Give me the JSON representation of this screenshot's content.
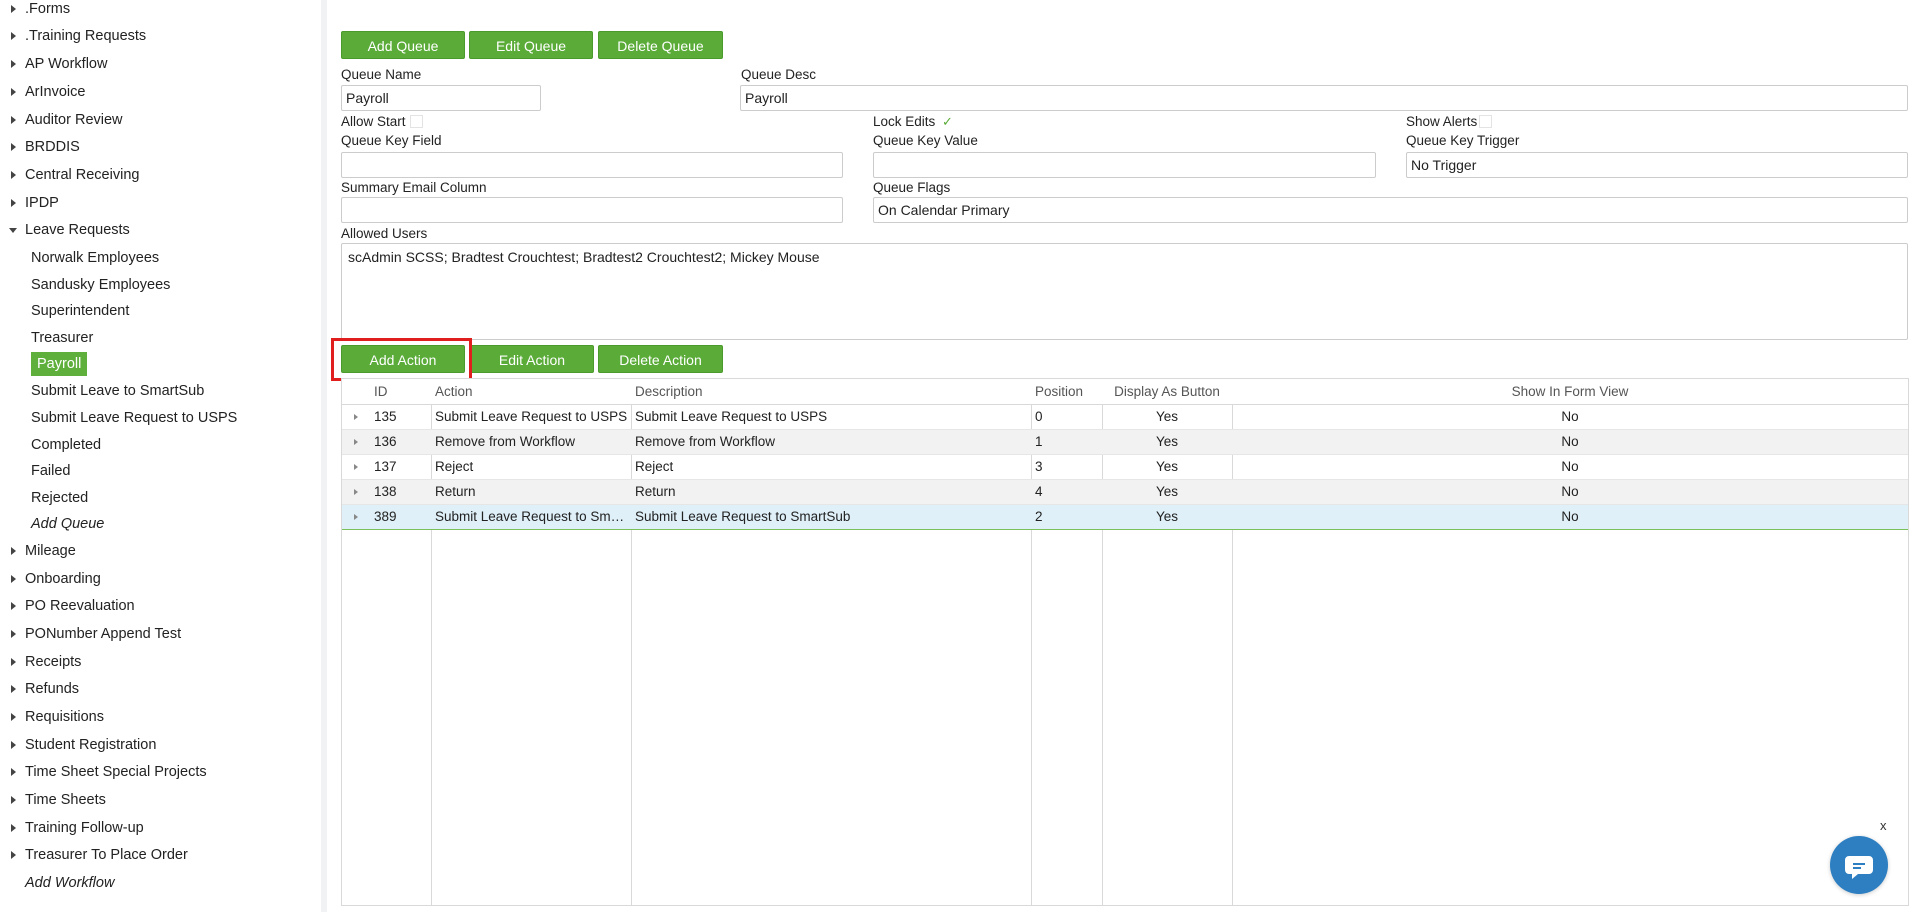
{
  "sidebar": {
    "workflows": [
      {
        "label": ".Forms"
      },
      {
        "label": ".Training Requests"
      },
      {
        "label": "AP Workflow"
      },
      {
        "label": "ArInvoice"
      },
      {
        "label": "Auditor Review"
      },
      {
        "label": "BRDDIS"
      },
      {
        "label": "Central Receiving"
      },
      {
        "label": "IPDP"
      },
      {
        "label": "Leave Requests"
      },
      {
        "label": "Mileage"
      },
      {
        "label": "Onboarding"
      },
      {
        "label": "PO Reevaluation"
      },
      {
        "label": "PONumber Append Test"
      },
      {
        "label": "Receipts"
      },
      {
        "label": "Refunds"
      },
      {
        "label": "Requisitions"
      },
      {
        "label": "Student Registration"
      },
      {
        "label": "Time Sheet Special Projects"
      },
      {
        "label": "Time Sheets"
      },
      {
        "label": "Training Follow-up"
      },
      {
        "label": "Treasurer To Place Order"
      }
    ],
    "leave_queues": [
      {
        "label": "Norwalk Employees"
      },
      {
        "label": "Sandusky Employees"
      },
      {
        "label": "Superintendent"
      },
      {
        "label": "Treasurer"
      },
      {
        "label": "Payroll"
      },
      {
        "label": "Submit Leave to SmartSub"
      },
      {
        "label": "Submit Leave Request to USPS"
      },
      {
        "label": "Completed"
      },
      {
        "label": "Failed"
      },
      {
        "label": "Rejected"
      }
    ],
    "add_queue": "Add Queue",
    "add_workflow": "Add Workflow"
  },
  "queue_toolbar": {
    "add": "Add Queue",
    "edit": "Edit Queue",
    "delete": "Delete Queue"
  },
  "form": {
    "queue_name_label": "Queue Name",
    "queue_name_value": "Payroll",
    "queue_desc_label": "Queue Desc",
    "queue_desc_value": "Payroll",
    "allow_start_label": "Allow Start",
    "lock_edits_label": "Lock Edits",
    "show_alerts_label": "Show Alerts",
    "queue_key_field_label": "Queue Key Field",
    "queue_key_field_value": "",
    "queue_key_value_label": "Queue Key Value",
    "queue_key_value_value": "",
    "queue_key_trigger_label": "Queue Key Trigger",
    "queue_key_trigger_value": "No Trigger",
    "summary_email_label": "Summary Email Column",
    "summary_email_value": "",
    "queue_flags_label": "Queue Flags",
    "queue_flags_value": "On Calendar Primary",
    "allowed_users_label": "Allowed Users",
    "allowed_users_value": "scAdmin SCSS; Bradtest Crouchtest; Bradtest2 Crouchtest2; Mickey Mouse"
  },
  "action_toolbar": {
    "add": "Add Action",
    "edit": "Edit Action",
    "delete": "Delete Action"
  },
  "grid": {
    "columns": [
      "ID",
      "Action",
      "Description",
      "Position",
      "Display As Button",
      "Show In Form View"
    ],
    "rows": [
      {
        "id": "135",
        "action": "Submit Leave Request to USPS",
        "description": "Submit Leave Request to USPS",
        "position": "0",
        "display_as_button": "Yes",
        "show_in_form_view": "No"
      },
      {
        "id": "136",
        "action": "Remove from Workflow",
        "description": "Remove from Workflow",
        "position": "1",
        "display_as_button": "Yes",
        "show_in_form_view": "No"
      },
      {
        "id": "137",
        "action": "Reject",
        "description": "Reject",
        "position": "3",
        "display_as_button": "Yes",
        "show_in_form_view": "No"
      },
      {
        "id": "138",
        "action": "Return",
        "description": "Return",
        "position": "4",
        "display_as_button": "Yes",
        "show_in_form_view": "No"
      },
      {
        "id": "389",
        "action": "Submit Leave Request to SmartSub",
        "description": "Submit Leave Request to SmartSub",
        "position": "2",
        "display_as_button": "Yes",
        "show_in_form_view": "No"
      }
    ]
  },
  "chat": {
    "close_label": "x"
  },
  "colors": {
    "accent_green": "#5aab38",
    "highlight_red": "#e01e1e",
    "chat_blue": "#2d7fc1"
  }
}
